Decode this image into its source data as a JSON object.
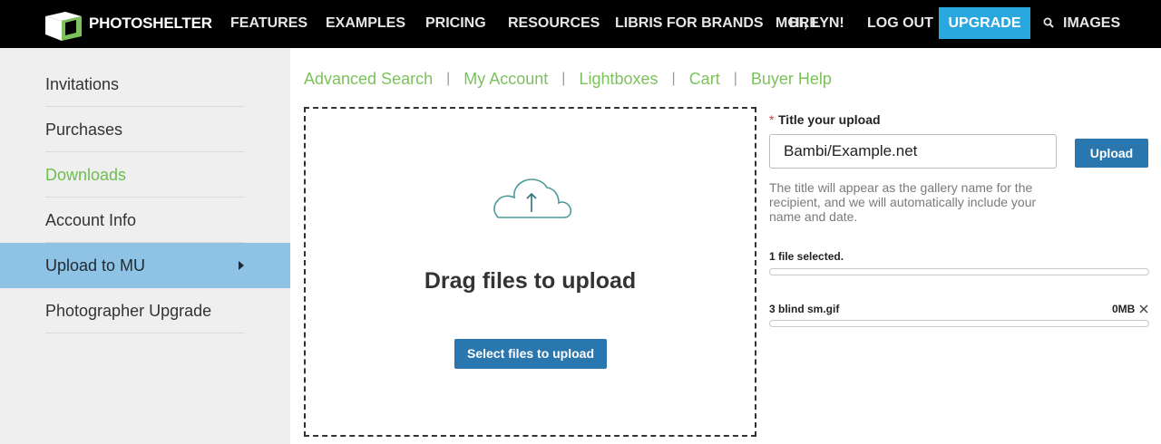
{
  "brand": {
    "name": "PHOTOSHELTER"
  },
  "nav": {
    "items": [
      "FEATURES",
      "EXAMPLES",
      "PRICING",
      "RESOURCES",
      "LIBRIS FOR BRANDS",
      "MORE",
      "HI, LYN!",
      "LOG OUT"
    ],
    "upgrade": "UPGRADE",
    "images": "IMAGES",
    "search_icon": "search-icon"
  },
  "sidebar": {
    "items": [
      {
        "label": "Invitations"
      },
      {
        "label": "Purchases"
      },
      {
        "label": "Downloads"
      },
      {
        "label": "Account Info"
      },
      {
        "label": "Upload to MU"
      },
      {
        "label": "Photographer Upgrade"
      }
    ],
    "active_index": 4,
    "highlight_index": 2
  },
  "subnav": {
    "links": [
      "Advanced Search",
      "My Account",
      "Lightboxes",
      "Cart",
      "Buyer Help"
    ],
    "separator": "|"
  },
  "dropzone": {
    "icon": "cloud-upload-icon",
    "heading": "Drag files to upload",
    "button": "Select files to upload"
  },
  "upload_form": {
    "required_mark": "*",
    "title_label": "Title your upload",
    "title_value": "Bambi/Example.net",
    "upload_button": "Upload",
    "help_text": "The title will appear as the gallery name for the recipient, and we will automatically include your name and date.",
    "files_selected": "1 file selected.",
    "files": [
      {
        "name": "3 blind sm.gif",
        "size": "0MB"
      }
    ]
  },
  "colors": {
    "nav_bg": "#000000",
    "upgrade_bg": "#29a8e0",
    "link_green": "#7cc25c",
    "sidebar_active": "#8ec3e6",
    "button_blue": "#2a77b0",
    "required_red": "#d9352b"
  }
}
